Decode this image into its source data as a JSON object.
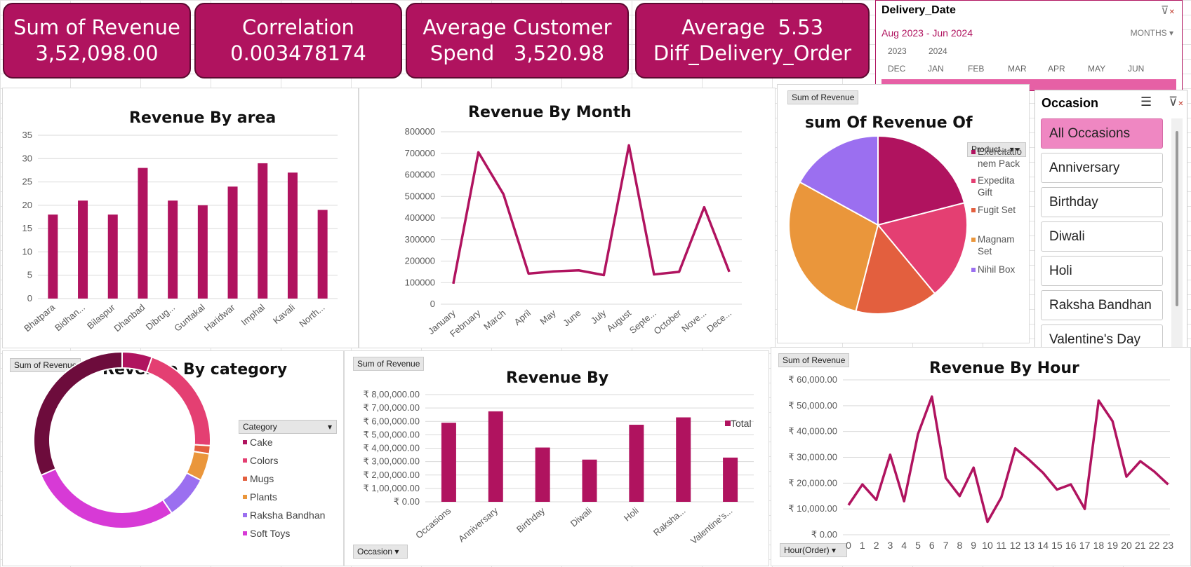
{
  "kpis": {
    "revenue": {
      "label": "Sum of Revenue",
      "value": "3,52,098.00"
    },
    "correlation": {
      "label": "Correlation",
      "value": "0.003478174"
    },
    "spend": {
      "label1": "Average Customer",
      "label2": "Spend",
      "value": "3,520.98"
    },
    "delivery": {
      "label1": "Average",
      "value": "5.53",
      "label2": "Diff_Delivery_Order"
    }
  },
  "timeline": {
    "title": "Delivery_Date",
    "range": "Aug 2023 - Jun 2024",
    "level": "MONTHS",
    "years": [
      "2023",
      "2024"
    ],
    "months": [
      "DEC",
      "JAN",
      "FEB",
      "MAR",
      "APR",
      "MAY",
      "JUN"
    ]
  },
  "occasion_slicer": {
    "title": "Occasion",
    "items": [
      "All Occasions",
      "Anniversary",
      "Birthday",
      "Diwali",
      "Holi",
      "Raksha Bandhan",
      "Valentine's Day"
    ],
    "selected": "All Occasions"
  },
  "colors": {
    "primary": "#b0135f",
    "border": "#5c0a31",
    "slicer_selected": "#ef87c2"
  },
  "chart_data": [
    {
      "id": "area",
      "type": "bar",
      "title": "Revenue By area",
      "categories": [
        "Bhatpara",
        "Bidhan...",
        "Bilaspur",
        "Dhanbad",
        "Dibrug...",
        "Guntakal",
        "Haridwar",
        "Imphal",
        "Kavali",
        "North..."
      ],
      "values": [
        18,
        21,
        18,
        28,
        21,
        20,
        24,
        29,
        27,
        19
      ],
      "ylim": [
        0,
        35
      ],
      "yticks": [
        "0",
        "5",
        "10",
        "15",
        "20",
        "25",
        "30",
        "35"
      ],
      "color": "#b0135f"
    },
    {
      "id": "month",
      "type": "line",
      "title": "Revenue By Month",
      "categories": [
        "January",
        "February",
        "March",
        "April",
        "May",
        "June",
        "July",
        "August",
        "Septe...",
        "October",
        "Nove...",
        "Dece..."
      ],
      "values": [
        95000,
        705000,
        510000,
        142000,
        152000,
        157000,
        135000,
        737000,
        138000,
        150000,
        450000,
        150000
      ],
      "ylim": [
        0,
        800000
      ],
      "yticks": [
        "0",
        "100000",
        "200000",
        "300000",
        "400000",
        "500000",
        "600000",
        "700000",
        "800000"
      ],
      "color": "#b0135f"
    },
    {
      "id": "product",
      "type": "pie",
      "title": "sum Of Revenue Of",
      "button": "Sum of Revenue",
      "filter_label": "Product...",
      "slices": [
        {
          "label": "Exercitationem Pack",
          "label_lines": [
            "Exercitatio",
            "nem Pack"
          ],
          "value": 21,
          "color": "#b0135f"
        },
        {
          "label": "Expedita Gift",
          "label_lines": [
            "Expedita",
            "Gift"
          ],
          "value": 18,
          "color": "#e43f72"
        },
        {
          "label": "Fugit Set",
          "label_lines": [
            "Fugit Set"
          ],
          "value": 15,
          "color": "#e35f3e"
        },
        {
          "label": "Magnam Set",
          "label_lines": [
            "Magnam",
            "Set"
          ],
          "value": 29,
          "color": "#ea963b"
        },
        {
          "label": "Nihil Box",
          "label_lines": [
            "Nihil Box"
          ],
          "value": 17,
          "color": "#9b6ff0"
        }
      ]
    },
    {
      "id": "category",
      "type": "donut",
      "title": "Revenue By category",
      "button": "Sum of Revenue",
      "filter_label": "Category",
      "slices": [
        {
          "label": "Cake",
          "value": 5.5,
          "color": "#b0135f"
        },
        {
          "label": "Colors",
          "value": 20.5,
          "color": "#e43f72"
        },
        {
          "label": "Mugs",
          "value": 1.5,
          "color": "#e35f3e"
        },
        {
          "label": "Plants",
          "value": 5,
          "color": "#ea963b"
        },
        {
          "label": "Raksha Bandhan",
          "value": 8,
          "color": "#9b6ff0"
        },
        {
          "label": "Soft Toys",
          "value": 28,
          "color": "#d73ad6"
        },
        {
          "label": "",
          "value": 31.5,
          "color": "#6d0c3c"
        }
      ]
    },
    {
      "id": "occasion",
      "type": "bar",
      "title": "Revenue By",
      "button": "Sum of Revenue",
      "filter_label": "Occasion",
      "legend": "Total",
      "categories": [
        "Occasions",
        "Anniversary",
        "Birthday",
        "Diwali",
        "Holi",
        "Raksha...",
        "Valentine's..."
      ],
      "values": [
        590000,
        675000,
        405000,
        315000,
        575000,
        630000,
        330000
      ],
      "ylim": [
        0,
        800000
      ],
      "yticks": [
        "₹ 0.00",
        "₹ 1,00,000.00",
        "₹ 2,00,000.00",
        "₹ 3,00,000.00",
        "₹ 4,00,000.00",
        "₹ 5,00,000.00",
        "₹ 6,00,000.00",
        "₹ 7,00,000.00",
        "₹ 8,00,000.00"
      ],
      "color": "#b0135f"
    },
    {
      "id": "hour",
      "type": "line",
      "title": "Revenue By Hour",
      "button": "Sum of Revenue",
      "filter_label": "Hour(Order)",
      "categories": [
        "0",
        "1",
        "2",
        "3",
        "4",
        "5",
        "6",
        "7",
        "8",
        "9",
        "10",
        "11",
        "12",
        "13",
        "14",
        "15",
        "16",
        "17",
        "18",
        "19",
        "20",
        "21",
        "22",
        "23"
      ],
      "values": [
        11500,
        19500,
        13500,
        31000,
        13000,
        39000,
        53500,
        22000,
        15000,
        26000,
        5000,
        14500,
        33500,
        29000,
        24000,
        17500,
        19500,
        10000,
        52000,
        44000,
        22500,
        28500,
        24500,
        19500
      ],
      "ylim": [
        0,
        60000
      ],
      "yticks": [
        "₹ 0.00",
        "₹ 10,000.00",
        "₹ 20,000.00",
        "₹ 30,000.00",
        "₹ 40,000.00",
        "₹ 50,000.00",
        "₹ 60,000.00"
      ],
      "color": "#b0135f"
    }
  ]
}
